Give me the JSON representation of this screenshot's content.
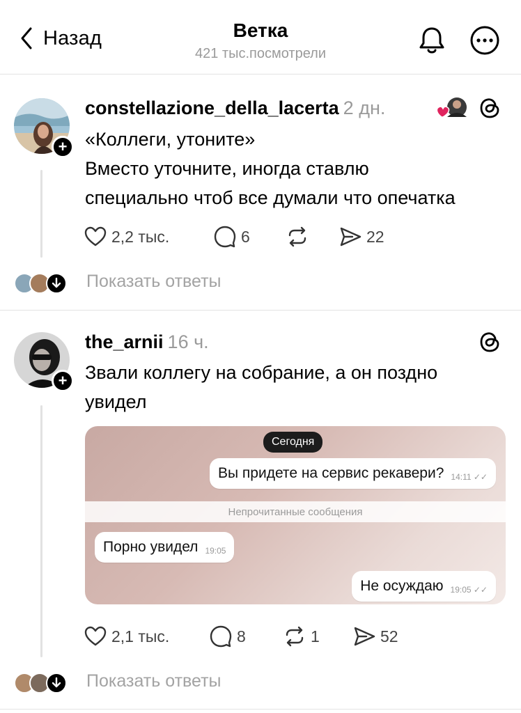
{
  "header": {
    "back_label": "Назад",
    "title": "Ветка",
    "subtitle": "421 тыс.посмотрели"
  },
  "posts": [
    {
      "username": "constellazione_della_lacerta",
      "time": "2 дн.",
      "lines": [
        "«Коллеги, утоните»",
        "Вместо уточните, иногда ставлю",
        "специально чтоб все думали что опечатка"
      ],
      "likes": "2,2 тыс.",
      "comments": "6",
      "reposts": "",
      "shares": "22",
      "show_replies": "Показать ответы"
    },
    {
      "username": "the_arnii",
      "time": "16 ч.",
      "lines": [
        "Звали коллегу на собрание, а он поздно",
        "увидел"
      ],
      "likes": "2,1 тыс.",
      "comments": "8",
      "reposts": "1",
      "shares": "52",
      "show_replies": "Показать ответы"
    }
  ],
  "chat_screenshot": {
    "date_label": "Сегодня",
    "unread_label": "Непрочитанные сообщения",
    "messages": [
      {
        "text": "Вы придете на сервис рекавери?",
        "time": "14:11"
      },
      {
        "text": "Порно увидел",
        "time": "19:05"
      },
      {
        "text": "Не осуждаю",
        "time": "19:05"
      }
    ]
  },
  "colors": {
    "accent": "#000000",
    "muted_text": "#9a9a9a",
    "like_heart": "#e0245e"
  },
  "icons": [
    "back-chevron-icon",
    "bell-icon",
    "more-icon",
    "threads-icon",
    "heart-icon",
    "comment-icon",
    "repost-icon",
    "share-icon"
  ]
}
